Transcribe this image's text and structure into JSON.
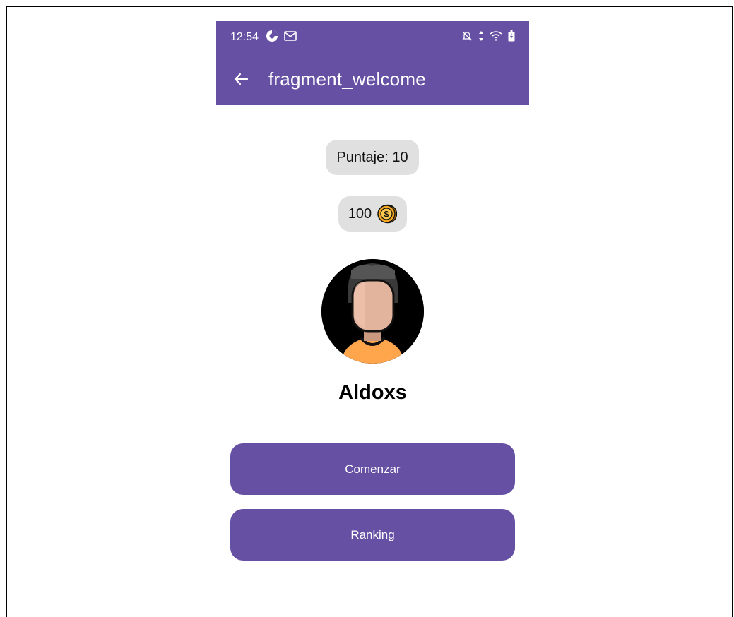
{
  "status_bar": {
    "time": "12:54",
    "left_icons": [
      "app-notification-icon",
      "gmail-icon"
    ],
    "right_icons": [
      "mute-icon",
      "data-arrows-icon",
      "wifi-icon",
      "battery-icon"
    ]
  },
  "toolbar": {
    "title": "fragment_welcome",
    "back_icon": "arrow-back-icon"
  },
  "stats": {
    "score_label": "Puntaje: 10",
    "coins_value": "100",
    "coin_icon": "coin-icon"
  },
  "profile": {
    "avatar_icon": "user-avatar-icon",
    "username": "Aldoxs"
  },
  "actions": {
    "start_label": "Comenzar",
    "ranking_label": "Ranking"
  },
  "colors": {
    "primary": "#6650a4",
    "pill_bg": "#e0e0e0",
    "coin": "#f5a623"
  }
}
